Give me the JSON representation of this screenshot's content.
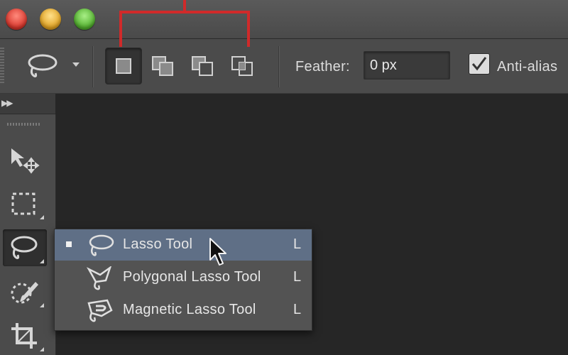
{
  "window": {
    "controls": [
      "close-button",
      "minimize-button",
      "maximize-button"
    ],
    "colors": {
      "close": "#d8342a",
      "minimize": "#e0a01e",
      "maximize": "#4fae2b"
    }
  },
  "annotation": {
    "color": "#d02a2a",
    "shape": "bracket"
  },
  "options_bar": {
    "tool_preset_icon": "lasso-icon",
    "selection_modes": [
      {
        "name": "new-selection",
        "icon": "new-selection-icon",
        "active": true
      },
      {
        "name": "add-to-selection",
        "icon": "add-to-selection-icon",
        "active": false
      },
      {
        "name": "subtract-from-selection",
        "icon": "subtract-from-selection-icon",
        "active": false
      },
      {
        "name": "intersect-with-selection",
        "icon": "intersect-with-selection-icon",
        "active": false
      }
    ],
    "feather_label": "Feather:",
    "feather_value": "0 px",
    "anti_alias_label": "Anti-alias",
    "anti_alias_checked": true
  },
  "tools_panel": {
    "collapse_icon": "double-chevron-right-icon",
    "tools": [
      {
        "name": "move-tool",
        "icon": "move-icon",
        "selected": false
      },
      {
        "name": "marquee-tool",
        "icon": "rectangular-marquee-icon",
        "selected": false
      },
      {
        "name": "lasso-tool",
        "icon": "lasso-icon",
        "selected": true
      },
      {
        "name": "quick-selection-tool",
        "icon": "quick-selection-brush-icon",
        "selected": false
      },
      {
        "name": "crop-tool",
        "icon": "crop-icon",
        "selected": false
      }
    ]
  },
  "flyout": {
    "highlight_color": "#5f6f86",
    "items": [
      {
        "label": "Lasso Tool",
        "shortcut": "L",
        "icon": "lasso-icon",
        "current": true
      },
      {
        "label": "Polygonal Lasso Tool",
        "shortcut": "L",
        "icon": "polygonal-lasso-icon",
        "current": false
      },
      {
        "label": "Magnetic Lasso Tool",
        "shortcut": "L",
        "icon": "magnetic-lasso-icon",
        "current": false
      }
    ]
  }
}
